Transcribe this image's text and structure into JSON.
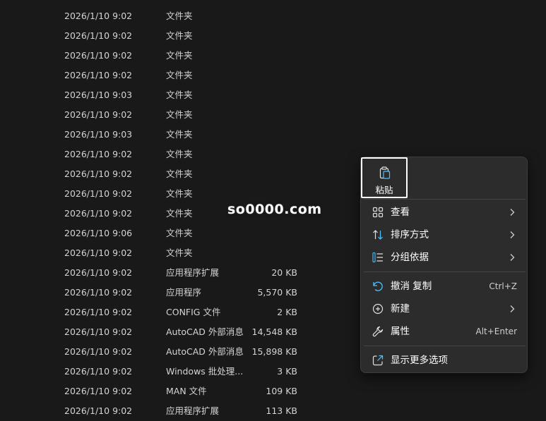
{
  "files": [
    {
      "date": "2026/1/10 9:02",
      "type": "文件夹",
      "size": ""
    },
    {
      "date": "2026/1/10 9:02",
      "type": "文件夹",
      "size": ""
    },
    {
      "date": "2026/1/10 9:02",
      "type": "文件夹",
      "size": ""
    },
    {
      "date": "2026/1/10 9:02",
      "type": "文件夹",
      "size": ""
    },
    {
      "date": "2026/1/10 9:03",
      "type": "文件夹",
      "size": ""
    },
    {
      "date": "2026/1/10 9:02",
      "type": "文件夹",
      "size": ""
    },
    {
      "date": "2026/1/10 9:03",
      "type": "文件夹",
      "size": ""
    },
    {
      "date": "2026/1/10 9:02",
      "type": "文件夹",
      "size": ""
    },
    {
      "date": "2026/1/10 9:02",
      "type": "文件夹",
      "size": ""
    },
    {
      "date": "2026/1/10 9:02",
      "type": "文件夹",
      "size": ""
    },
    {
      "date": "2026/1/10 9:02",
      "type": "文件夹",
      "size": ""
    },
    {
      "date": "2026/1/10 9:06",
      "type": "文件夹",
      "size": ""
    },
    {
      "date": "2026/1/10 9:02",
      "type": "文件夹",
      "size": ""
    },
    {
      "date": "2026/1/10 9:02",
      "type": "应用程序扩展",
      "size": "20 KB"
    },
    {
      "date": "2026/1/10 9:02",
      "type": "应用程序",
      "size": "5,570 KB"
    },
    {
      "date": "2026/1/10 9:02",
      "type": "CONFIG 文件",
      "size": "2 KB"
    },
    {
      "date": "2026/1/10 9:02",
      "type": "AutoCAD 外部消息",
      "size": "14,548 KB"
    },
    {
      "date": "2026/1/10 9:02",
      "type": "AutoCAD 外部消息",
      "size": "15,898 KB"
    },
    {
      "date": "2026/1/10 9:02",
      "type": "Windows 批处理...",
      "size": "3 KB"
    },
    {
      "date": "2026/1/10 9:02",
      "type": "MAN 文件",
      "size": "109 KB"
    },
    {
      "date": "2026/1/10 9:02",
      "type": "应用程序扩展",
      "size": "113 KB"
    }
  ],
  "watermark": "so0000.com",
  "context_menu": {
    "paste_label": "粘贴",
    "items": [
      {
        "label": "查看",
        "shortcut": "",
        "icon": "grid-icon",
        "submenu": true
      },
      {
        "label": "排序方式",
        "shortcut": "",
        "icon": "sort-icon",
        "submenu": true
      },
      {
        "label": "分组依据",
        "shortcut": "",
        "icon": "group-list-icon",
        "submenu": true
      },
      {
        "label": "撤消 复制",
        "shortcut": "Ctrl+Z",
        "icon": "undo-icon",
        "submenu": false
      },
      {
        "label": "新建",
        "shortcut": "",
        "icon": "plus-circle-icon",
        "submenu": true
      },
      {
        "label": "属性",
        "shortcut": "Alt+Enter",
        "icon": "wrench-icon",
        "submenu": false
      },
      {
        "label": "显示更多选项",
        "shortcut": "",
        "icon": "external-open-icon",
        "submenu": false
      }
    ]
  },
  "colors": {
    "background": "#191919",
    "menu_bg": "#2c2c2c",
    "icon_accent": "#4cc2ff"
  }
}
